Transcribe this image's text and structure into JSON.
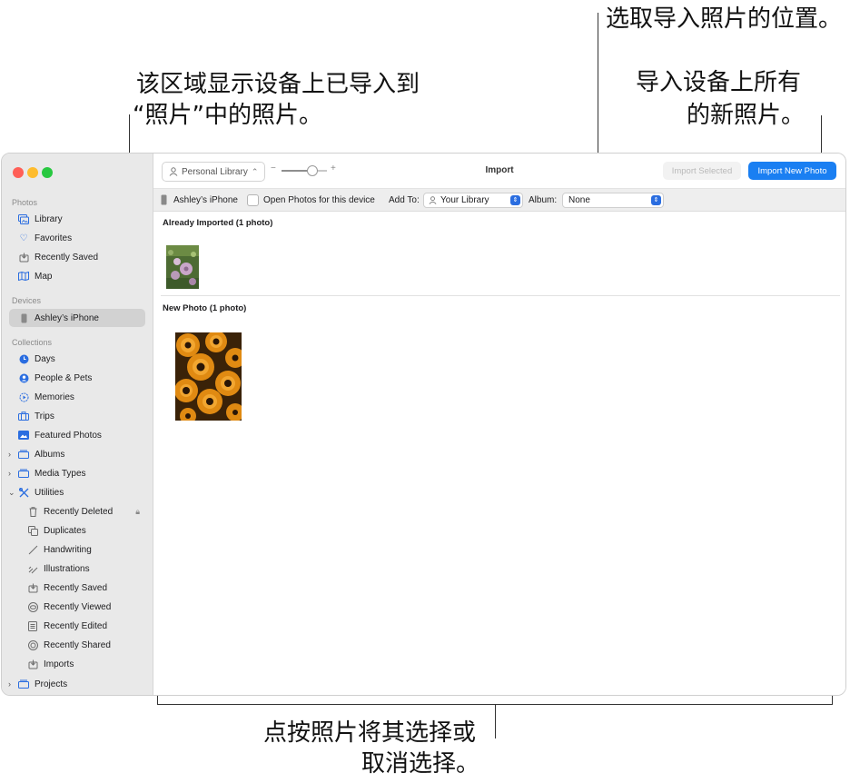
{
  "callouts": {
    "top_right": "选取导入照片的位置。",
    "import_all_line1": "导入设备上所有",
    "import_all_line2": "的新照片。",
    "imported_line1": "该区域显示设备上已导入到",
    "imported_line2": "“照片”中的照片。",
    "bottom_line1": "点按照片将其选择或",
    "bottom_line2": "取消选择。"
  },
  "toolbar": {
    "library_popup": "Personal Library",
    "title": "Import",
    "import_selected": "Import Selected",
    "import_new": "Import New Photo"
  },
  "device_bar": {
    "device_name": "Ashley’s iPhone",
    "open_photos_label": "Open Photos for this device",
    "add_to_label": "Add To:",
    "add_to_value": "Your Library",
    "album_label": "Album:",
    "album_value": "None"
  },
  "sidebar": {
    "photos_section": "Photos",
    "library": "Library",
    "favorites": "Favorites",
    "recently_saved": "Recently Saved",
    "map": "Map",
    "devices_section": "Devices",
    "device": "Ashley’s iPhone",
    "collections_section": "Collections",
    "days": "Days",
    "people_pets": "People & Pets",
    "memories": "Memories",
    "trips": "Trips",
    "featured_photos": "Featured Photos",
    "albums": "Albums",
    "media_types": "Media Types",
    "utilities": "Utilities",
    "recently_deleted": "Recently Deleted",
    "duplicates": "Duplicates",
    "handwriting": "Handwriting",
    "illustrations": "Illustrations",
    "util_recently_saved": "Recently Saved",
    "recently_viewed": "Recently Viewed",
    "recently_edited": "Recently Edited",
    "recently_shared": "Recently Shared",
    "imports": "Imports",
    "projects": "Projects"
  },
  "main": {
    "already_imported": "Already Imported (1 photo)",
    "new_photo": "New Photo (1 photo)"
  },
  "colors": {
    "accent": "#1a7ff2",
    "sidebar_icon": "#2a6de0",
    "traffic_red": "#ff5f57",
    "traffic_yellow": "#febc2e",
    "traffic_green": "#28c840"
  },
  "icons": {
    "library": "photo-library-icon",
    "favorites": "heart-icon",
    "map": "map-icon",
    "device": "iphone-icon"
  }
}
